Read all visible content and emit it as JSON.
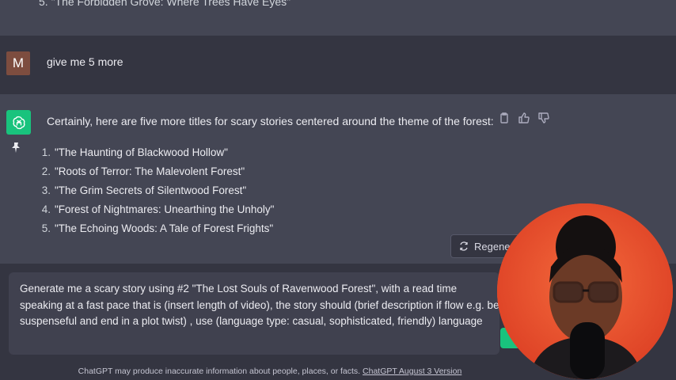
{
  "previous_message": {
    "last_line_number": "5.",
    "last_line_text": "\"The Forbidden Grove: Where Trees Have Eyes\""
  },
  "user_message": {
    "avatar_initial": "M",
    "text": "give me 5 more"
  },
  "assistant_message": {
    "intro": "Certainly, here are five more titles for scary stories centered around the theme of the forest:",
    "items": [
      {
        "num": "1.",
        "text": "\"The Haunting of Blackwood Hollow\""
      },
      {
        "num": "2.",
        "text": "\"Roots of Terror: The Malevolent Forest\""
      },
      {
        "num": "3.",
        "text": "\"The Grim Secrets of Silentwood Forest\""
      },
      {
        "num": "4.",
        "text": "\"Forest of Nightmares: Unearthing the Unholy\""
      },
      {
        "num": "5.",
        "text": "\"The Echoing Woods: A Tale of Forest Frights\""
      }
    ]
  },
  "regenerate_label": "Regener",
  "composer": {
    "value": "Generate me a scary story using #2 \"The Lost Souls of Ravenwood Forest\", with a read time speaking at a fast pace that is (insert length of video), the story should (brief description if flow e.g. be suspenseful and end in a plot twist) , use (language type: casual, sophisticated, friendly) language"
  },
  "footer": {
    "text": "ChatGPT may produce inaccurate information about people, places, or facts.",
    "link": "ChatGPT August 3 Version"
  },
  "colors": {
    "background": "#343541",
    "assistant_row": "#444654",
    "accent": "#19c37d",
    "user_avatar": "#7d4d3f",
    "webcam_backdrop": "#f0562f"
  }
}
